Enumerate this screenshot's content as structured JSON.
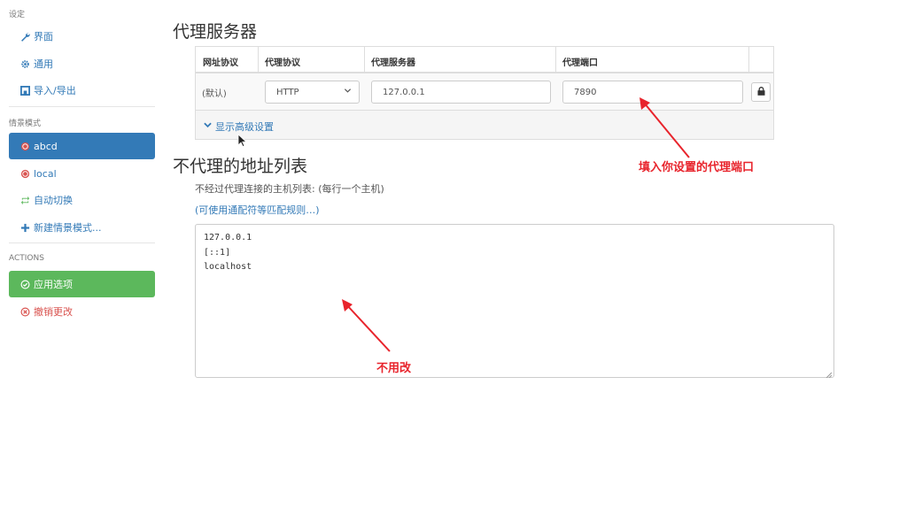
{
  "sidebar": {
    "settings_header": "设定",
    "settings_items": [
      {
        "label": "界面",
        "icon": "wrench-icon"
      },
      {
        "label": "通用",
        "icon": "gear-icon"
      },
      {
        "label": "导入/导出",
        "icon": "import-export-icon"
      }
    ],
    "profiles_header": "情景模式",
    "profiles": [
      {
        "label": "abcd",
        "icon": "globe-icon",
        "active": true
      },
      {
        "label": "local",
        "icon": "globe-icon",
        "active": false
      },
      {
        "label": "自动切换",
        "icon": "switch-icon",
        "active": false
      },
      {
        "label": "新建情景模式...",
        "icon": "plus-icon",
        "active": false
      }
    ],
    "actions_header": "ACTIONS",
    "apply_label": "应用选项",
    "revert_label": "撤销更改"
  },
  "proxy_section": {
    "title": "代理服务器",
    "columns": [
      "网址协议",
      "代理协议",
      "代理服务器",
      "代理端口"
    ],
    "row": {
      "scheme": "(默认)",
      "protocol": "HTTP",
      "server": "127.0.0.1",
      "port": "7890"
    },
    "advanced_link": "显示高级设置"
  },
  "bypass_section": {
    "title": "不代理的地址列表",
    "description": "不经过代理连接的主机列表: (每行一个主机)",
    "wildcard_link": "(可使用通配符等匹配规则…)",
    "entries": [
      "127.0.0.1",
      "[::1]",
      "localhost"
    ]
  },
  "annotations": {
    "port_note": "填入你设置的代理端口",
    "bypass_note": "不用改",
    "color": "#e8242c"
  },
  "colors": {
    "primary": "#337ab7",
    "success": "#5cb85c",
    "danger": "#d9534f"
  }
}
